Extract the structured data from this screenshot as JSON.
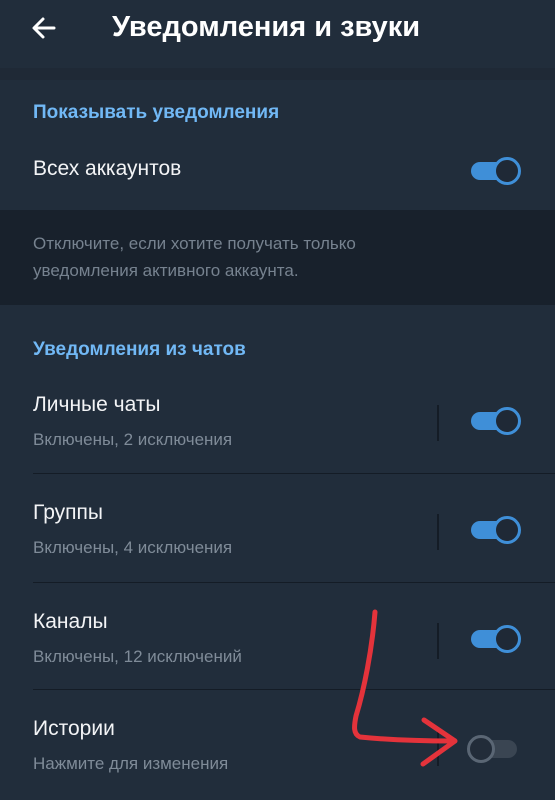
{
  "header": {
    "title": "Уведомления и звуки",
    "back_icon": "arrow-left-icon"
  },
  "show_notifications": {
    "section_title": "Показывать уведомления",
    "all_accounts_label": "Всех аккаунтов",
    "all_accounts_enabled": true,
    "info_line1": "Отключите, если хотите получать только",
    "info_line2": "уведомления активного аккаунта."
  },
  "chat_notifications": {
    "section_title": "Уведомления из чатов",
    "items": [
      {
        "title": "Личные чаты",
        "subtitle": "Включены, 2 исключения",
        "enabled": true
      },
      {
        "title": "Группы",
        "subtitle": "Включены, 4 исключения",
        "enabled": true
      },
      {
        "title": "Каналы",
        "subtitle": "Включены, 12 исключений",
        "enabled": true
      },
      {
        "title": "Истории",
        "subtitle": "Нажмите для изменения",
        "enabled": false
      }
    ]
  },
  "colors": {
    "background": "#1f2936",
    "accent": "#71b8f5",
    "toggle_on": "#3f8fd8",
    "annotation_red": "#e4333b"
  }
}
